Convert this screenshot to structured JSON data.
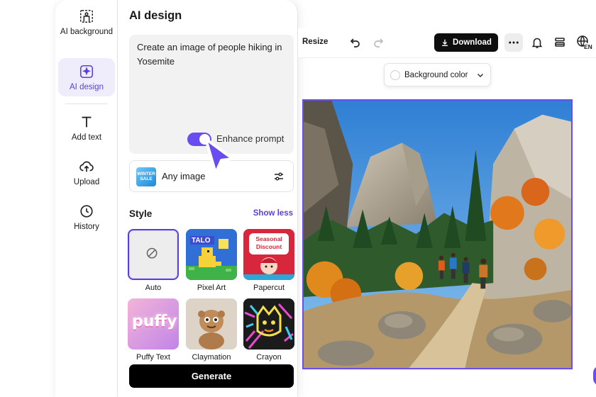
{
  "rail": {
    "items": [
      {
        "label": "AI background",
        "icon": "ai-background-icon"
      },
      {
        "label": "AI design",
        "icon": "ai-design-icon"
      },
      {
        "label": "Add text",
        "icon": "text-icon"
      },
      {
        "label": "Upload",
        "icon": "upload-icon"
      },
      {
        "label": "History",
        "icon": "history-icon"
      }
    ]
  },
  "panel": {
    "title": "AI design",
    "prompt": "Create an image of people hiking in Yosemite",
    "enhance_label": "Enhance prompt",
    "enhance_on": true,
    "image_type": {
      "label": "Any image",
      "thumb_text": "WINTER SALE"
    },
    "style_title": "Style",
    "show_less": "Show less",
    "styles": [
      {
        "label": "Auto",
        "selected": true
      },
      {
        "label": "Pixel Art",
        "thumb_text": "TALO"
      },
      {
        "label": "Papercut",
        "thumb_text": "Seasonal Discount"
      },
      {
        "label": "Puffy Text",
        "thumb_text": "puffy"
      },
      {
        "label": "Claymation"
      },
      {
        "label": "Crayon"
      }
    ],
    "generate": "Generate"
  },
  "toolbar": {
    "resize": "Resize",
    "download": "Download",
    "lang": "EN"
  },
  "canvas": {
    "bgcolor_label": "Background color"
  },
  "colors": {
    "accent": "#6a4df0",
    "active_bg": "#efedfb"
  }
}
